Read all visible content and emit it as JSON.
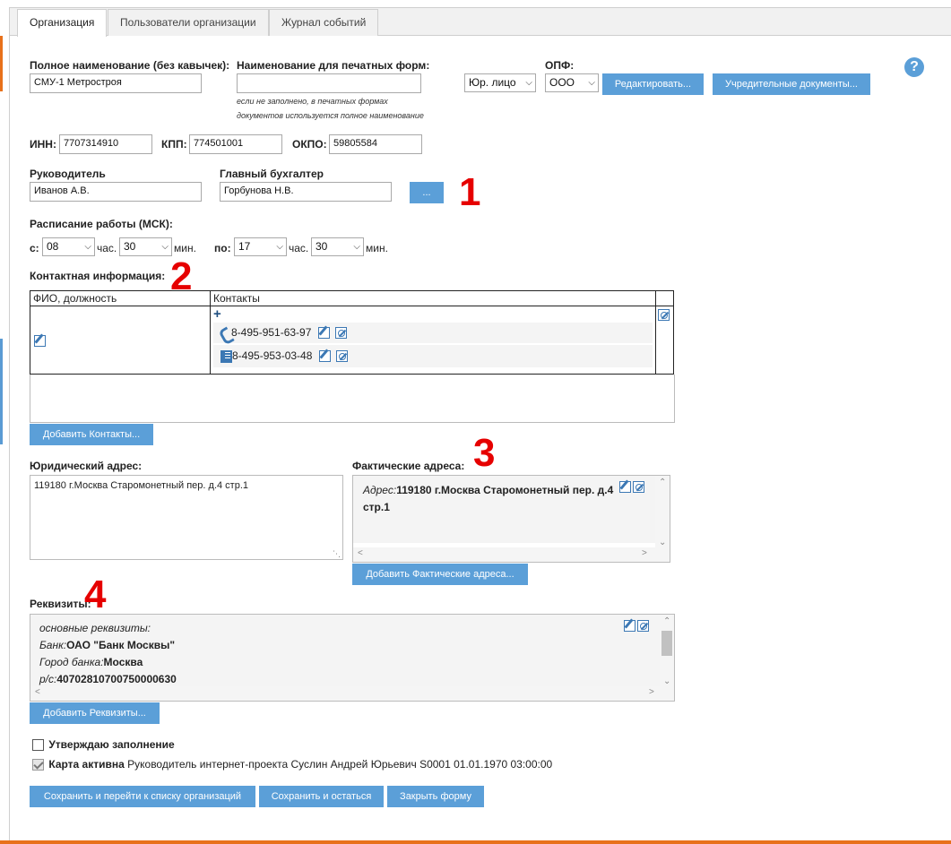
{
  "tabs": [
    {
      "label": "Организация"
    },
    {
      "label": "Пользователи организации"
    },
    {
      "label": "Журнал событий"
    }
  ],
  "form": {
    "full_name_label": "Полное наименование (без кавычек):",
    "full_name_value": "СМУ-1 Метростроя",
    "print_name_label": "Наименование для печатных форм:",
    "print_name_value": "",
    "print_name_hint1": "если не заполнено, в печатных формах",
    "print_name_hint2": "документов используется полное наименование",
    "entity_type": "Юр. лицо",
    "opf_label": "ОПФ:",
    "opf_value": "ООО",
    "edit_button": "Редактировать...",
    "founding_docs_button": "Учредительные документы...",
    "help": "?",
    "inn_label": "ИНН:",
    "inn_value": "7707314910",
    "kpp_label": "КПП:",
    "kpp_value": "774501001",
    "okpo_label": "ОКПО:",
    "okpo_value": "59805584",
    "director_label": "Руководитель",
    "director_value": "Иванов А.В.",
    "accountant_label": "Главный бухгалтер",
    "accountant_value": "Горбунова Н.В.",
    "more_button": "...",
    "schedule_label": "Расписание работы (МСК):",
    "from_label": "с:",
    "from_hour": "08",
    "hour_unit": "час.",
    "from_min": "30",
    "min_unit": "мин.",
    "to_label": "по:",
    "to_hour": "17",
    "to_min": "30"
  },
  "contacts": {
    "label": "Контактная информация:",
    "col_name": "ФИО, должность",
    "col_contacts": "Контакты",
    "add_symbol": "+",
    "entries": [
      {
        "type": "phone-icon",
        "value": "8-495-951-63-97"
      },
      {
        "type": "fax-icon",
        "value": "8-495-953-03-48"
      }
    ],
    "add_button": "Добавить Контакты..."
  },
  "legal_address": {
    "label": "Юридический адрес:",
    "value": "119180 г.Москва Старомонетный пер. д.4 стр.1"
  },
  "actual_address": {
    "label": "Фактические адреса:",
    "prefix": "Адрес:",
    "value_line1": "119180 г.Москва Старомонетный пер. д.4",
    "value_line2": "стр.1",
    "add_button": "Добавить Фактические адреса..."
  },
  "requisites": {
    "label": "Реквизиты:",
    "header": "основные реквизиты:",
    "rows": [
      {
        "key": "Банк:",
        "value": "ОАО \"Банк Москвы\""
      },
      {
        "key": "Город банка:",
        "value": "Москва"
      },
      {
        "key": "р/с:",
        "value": "40702810700750000630"
      }
    ],
    "add_button": "Добавить Реквизиты..."
  },
  "approve": {
    "label": "Утверждаю заполнение",
    "checked": false
  },
  "card_active": {
    "label": "Карта активна",
    "detail": "Руководитель интернет-проекта Суслин Андрей Юрьевич S0001 01.01.1970 03:00:00",
    "checked": true
  },
  "actions": {
    "save_and_list": "Сохранить и перейти к списку организаций",
    "save_and_stay": "Сохранить и остаться",
    "close": "Закрыть форму"
  },
  "annotations": [
    "1",
    "2",
    "3",
    "4"
  ],
  "colors": {
    "button_blue": "#5b9fd8",
    "accent_orange": "#e8711b",
    "annotation_red": "#e60000",
    "icon_blue": "#3c78b4"
  }
}
